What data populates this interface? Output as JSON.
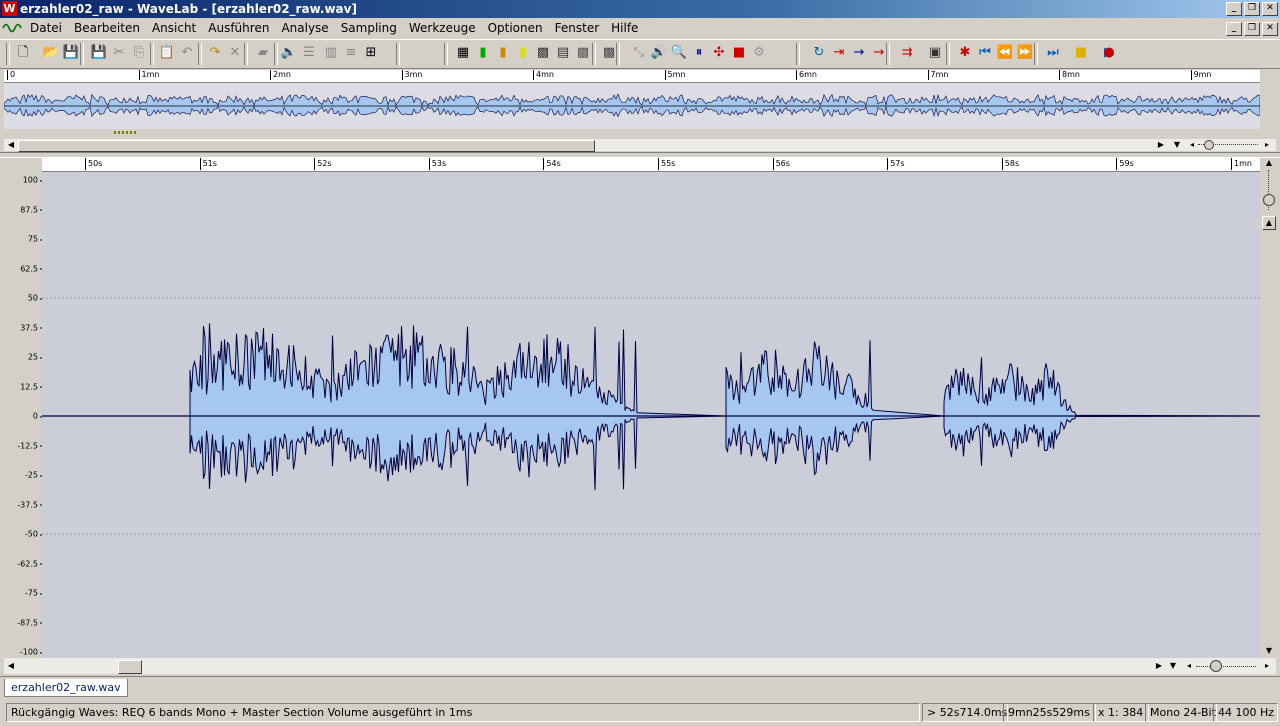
{
  "window": {
    "title": "erzahler02_raw - WaveLab - [erzahler02_raw.wav]"
  },
  "menu": {
    "items": [
      "Datei",
      "Bearbeiten",
      "Ansicht",
      "Ausführen",
      "Analyse",
      "Sampling",
      "Werkzeuge",
      "Optionen",
      "Fenster",
      "Hilfe"
    ]
  },
  "toolbar": {
    "icons": [
      "new-file-icon",
      "open-folder-icon",
      "save-icon",
      "save-as-icon",
      "cut-icon",
      "copy-icon",
      "paste-icon",
      "undo-icon",
      "redo-icon",
      "delete-icon",
      "eraser-icon",
      "speaker-icon",
      "view-stack-icon",
      "view-split-icon",
      "view-lanes-icon",
      "view-ruler-icon",
      "view-grid-icon",
      "level-meter-icon",
      "spectroscope-icon",
      "bar-analyzer-icon",
      "oscilloscope-icon",
      "phase-icon",
      "wavescope-icon",
      "spectrum-icon",
      "stretch-icon",
      "play-tool-icon",
      "zoom-tool-icon",
      "pause-tool-icon",
      "marker-cut-icon",
      "marker-red-icon",
      "gear-tool-icon",
      "loop-icon",
      "insert-marker-icon",
      "marker-arrow-icon",
      "marker-right-icon",
      "marker-double-icon",
      "snapshot-icon",
      "split-red-icon",
      "go-start-icon",
      "rewind-icon",
      "fast-forward-icon",
      "go-end-icon",
      "stop-icon",
      "play-icon",
      "record-icon"
    ]
  },
  "overview": {
    "ticks": [
      "0",
      "1mn",
      "2mn",
      "3mn",
      "4mn",
      "5mn",
      "6mn",
      "7mn",
      "8mn",
      "9mn"
    ]
  },
  "main": {
    "ruler": [
      "50s",
      "51s",
      "52s",
      "53s",
      "54s",
      "55s",
      "56s",
      "57s",
      "58s",
      "59s",
      "1mn"
    ],
    "y_axis": [
      "100",
      "87.5",
      "75",
      "62.5",
      "50",
      "37.5",
      "25",
      "12.5",
      "0",
      "-12.5",
      "-25",
      "-37.5",
      "-50",
      "-62.5",
      "-75",
      "-87.5",
      "-100"
    ]
  },
  "tabs": {
    "active": "erzahler02_raw.wav"
  },
  "status": {
    "message": "Rückgängig Waves: REQ 6 bands Mono + Master Section Volume ausgeführt in 1ms",
    "cursor": "> 52s714.0ms",
    "length": "9mn25s529ms",
    "zoom": "x 1: 384",
    "format": "Mono 24-Bit",
    "rate": "44 100 Hz"
  },
  "colors": {
    "wave_fill": "#a6c8f0",
    "wave_line": "#000040",
    "wave_bg": "#cbcdd8",
    "title_bar": "#0a246a"
  }
}
